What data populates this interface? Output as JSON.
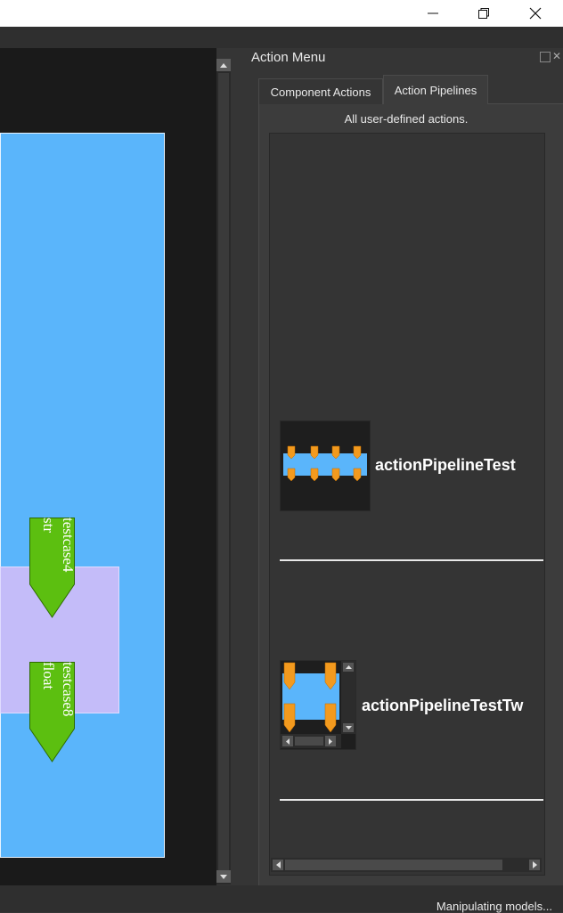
{
  "window": {
    "minimize_icon": "minimize-icon",
    "restore_icon": "restore-icon",
    "close_icon": "close-icon"
  },
  "canvas": {
    "blocks": [
      {
        "name": "testcase4",
        "type": "str"
      },
      {
        "name": "testcase8",
        "type": "float"
      }
    ]
  },
  "action_menu": {
    "title": "Action Menu",
    "tabs": [
      {
        "label": "Component Actions",
        "active": false
      },
      {
        "label": "Action Pipelines",
        "active": true
      }
    ],
    "description": "All user-defined actions.",
    "pipelines": [
      {
        "label": "actionPipelineTest"
      },
      {
        "label": "actionPipelineTestTw"
      }
    ]
  },
  "status": {
    "text": "Manipulating models..."
  },
  "colors": {
    "canvas_bg": "#1a1a1a",
    "model_blue": "#5ab5fb",
    "model_lavender": "#c4bcf9",
    "block_green": "#5cbf10",
    "port_orange": "#f39a1e"
  }
}
